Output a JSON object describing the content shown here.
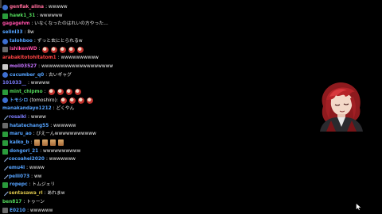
{
  "chat": {
    "messages": [
      {
        "badge": "sub",
        "user": "genflak_alina",
        "color": "#ff6b9a",
        "text": ": wwwww"
      },
      {
        "badge": "mod",
        "user": "hawk1_31",
        "color": "#53d95b",
        "text": ": wwwwww"
      },
      {
        "badge": "",
        "user": "gagagehm",
        "color": "#ff4fa8",
        "text": ": いなくなったのはれいの方やった…"
      },
      {
        "badge": "",
        "user": "selini33",
        "color": "#55a3ff",
        "text": ": 8w"
      },
      {
        "badge": "sub",
        "user": "taiohboo",
        "color": "#55a3ff",
        "text": ": ずっと玄にとられるw"
      },
      {
        "badge": "card",
        "user": "ishikenWD",
        "color": "#ff4fa8",
        "text": ":",
        "emotes": 5,
        "emote_type": "face"
      },
      {
        "badge": "",
        "user": "arabakitotohitatom1",
        "color": "#ff4444",
        "text": ": wwwwwwwwww"
      },
      {
        "badge": "star",
        "user": "moli03527",
        "color": "#c673ff",
        "text": ": wwwwwwwwwwwwwwwwwww"
      },
      {
        "badge": "sub",
        "user": "cucumber_q0",
        "color": "#55a3ff",
        "text": ": 古いギャグ"
      },
      {
        "badge": "",
        "user": "101033__",
        "color": "#7d7dff",
        "text": ": wwwww"
      },
      {
        "badge": "mod",
        "user": "mint_chipmo",
        "color": "#53d95b",
        "text": ":",
        "emotes": 4,
        "emote_type": "face"
      },
      {
        "badge": "sub",
        "user": "トモシロ",
        "color": "#55a3ff",
        "text": "(tomoshiro):",
        "emotes": 4,
        "emote_type": "face"
      },
      {
        "badge": "",
        "user": "manakandayo1212",
        "color": "#55a3ff",
        "text": ": どくやん"
      },
      {
        "badge": "sword",
        "user": "rosaiki",
        "color": "#7d7dff",
        "text": ": wwww"
      },
      {
        "badge": "card",
        "user": "hatatechang55",
        "color": "#55a3ff",
        "text": ": wwwwww"
      },
      {
        "badge": "mod",
        "user": "maru_ao",
        "color": "#55a3ff",
        "text": ": びえーんwwwwwwwwwww"
      },
      {
        "badge": "mod",
        "user": "kaiko_b",
        "color": "#55a3ff",
        "text": ":",
        "emotes": 4,
        "emote_type": "hands"
      },
      {
        "badge": "mod",
        "user": "dongori_21",
        "color": "#55a3ff",
        "text": ": wwwwwwwwww"
      },
      {
        "badge": "sword",
        "user": "cocoahei2020",
        "color": "#55a3ff",
        "text": ": wwwwwww"
      },
      {
        "badge": "sword",
        "user": "emu4l",
        "color": "#55a3ff",
        "text": ": wwww"
      },
      {
        "badge": "sword",
        "user": "pelli073",
        "color": "#55a3ff",
        "text": ": ww"
      },
      {
        "badge": "mod",
        "user": "ropepc",
        "color": "#55a3ff",
        "text": ": トムジェリ"
      },
      {
        "badge": "sword",
        "user": "sentasawa_rl",
        "color": "#d8c24a",
        "text": ": あれまw"
      },
      {
        "badge": "",
        "user": "ben817",
        "color": "#53d95b",
        "text": ": トゥーン"
      },
      {
        "badge": "card",
        "user": "E0210",
        "color": "#55a3ff",
        "text": ": wwwwww"
      }
    ]
  },
  "colors": {
    "background": "#000000",
    "chat_text": "#e8e8e8"
  }
}
